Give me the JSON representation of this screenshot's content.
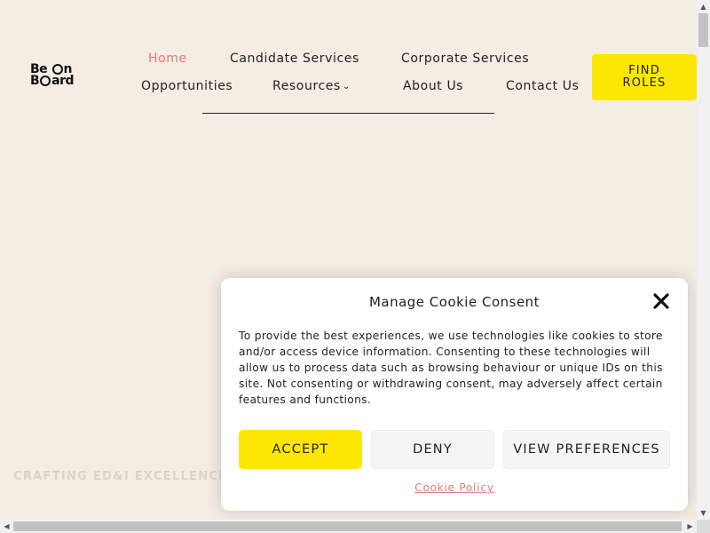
{
  "brand": {
    "logo_line1": "Be On",
    "logo_line1_a": "Be ",
    "logo_line1_b": "n",
    "logo_line2_a": "B",
    "logo_line2_b": "ard"
  },
  "nav": {
    "home": "Home",
    "candidate_services": "Candidate Services",
    "corporate_services": "Corporate Services",
    "opportunities": "Opportunities",
    "resources": "Resources",
    "about_us": "About Us",
    "contact_us": "Contact Us",
    "find_roles": "FIND ROLES"
  },
  "hero": {
    "tagline": "CRAFTING ED&I EXCELLENCE,"
  },
  "cookie": {
    "title": "Manage Cookie Consent",
    "body": "To provide the best experiences, we use technologies like cookies to store and/or access device information. Consenting to these technologies will allow us to process data such as browsing behaviour or unique IDs on this site. Not consenting or withdrawing consent, may adversely affect certain features and functions.",
    "accept": "ACCEPT",
    "deny": "DENY",
    "view_preferences": "VIEW PREFERENCES",
    "policy_link": "Cookie Policy"
  },
  "colors": {
    "background": "#f5ece4",
    "accent_yellow": "#fde600",
    "active_link": "#e07a7a"
  },
  "icons": {
    "close": "close-icon",
    "chevron": "chevron-down-icon"
  }
}
